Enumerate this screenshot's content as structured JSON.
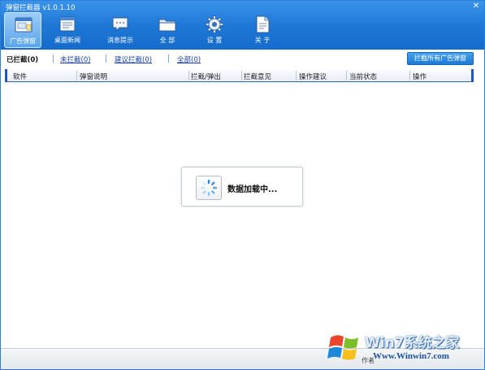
{
  "app": {
    "title": "弹窗拦截器 v1.0.1.10",
    "close_glyph": "✕"
  },
  "toolbar": {
    "items": [
      {
        "label": "广告弹窗",
        "icon": "popup-window-icon",
        "active": true
      },
      {
        "label": "桌面新闻",
        "icon": "desktop-news-icon",
        "active": false
      },
      {
        "label": "消息提示",
        "icon": "message-bubble-icon",
        "active": false
      },
      {
        "label": "全 部",
        "icon": "folder-icon",
        "active": false
      },
      {
        "label": "设 置",
        "icon": "gear-icon",
        "active": false
      },
      {
        "label": "关 于",
        "icon": "document-icon",
        "active": false
      }
    ]
  },
  "filters": {
    "blocked": "已拦截(0)",
    "unblocked": "未拦截(0)",
    "suggested": "建议拦截(0)",
    "all": "全部(0)",
    "block_all_button": "拦截所有广告弹窗"
  },
  "table": {
    "columns": [
      "软件",
      "弹窗说明",
      "拦截/弹出",
      "拦截意见",
      "操作建议",
      "当前状态",
      "操作"
    ],
    "rows": []
  },
  "loading": {
    "text": "数据加载中...",
    "icon": "loading-spinner-icon"
  },
  "statusbar": {
    "author": "作者"
  },
  "watermark": {
    "title": "Win7系统之家",
    "url": "Www.Winwin7.com"
  },
  "colors": {
    "accent": "#1f78d6",
    "link": "#1a3fa8",
    "header_rule": "#2d62c6"
  }
}
